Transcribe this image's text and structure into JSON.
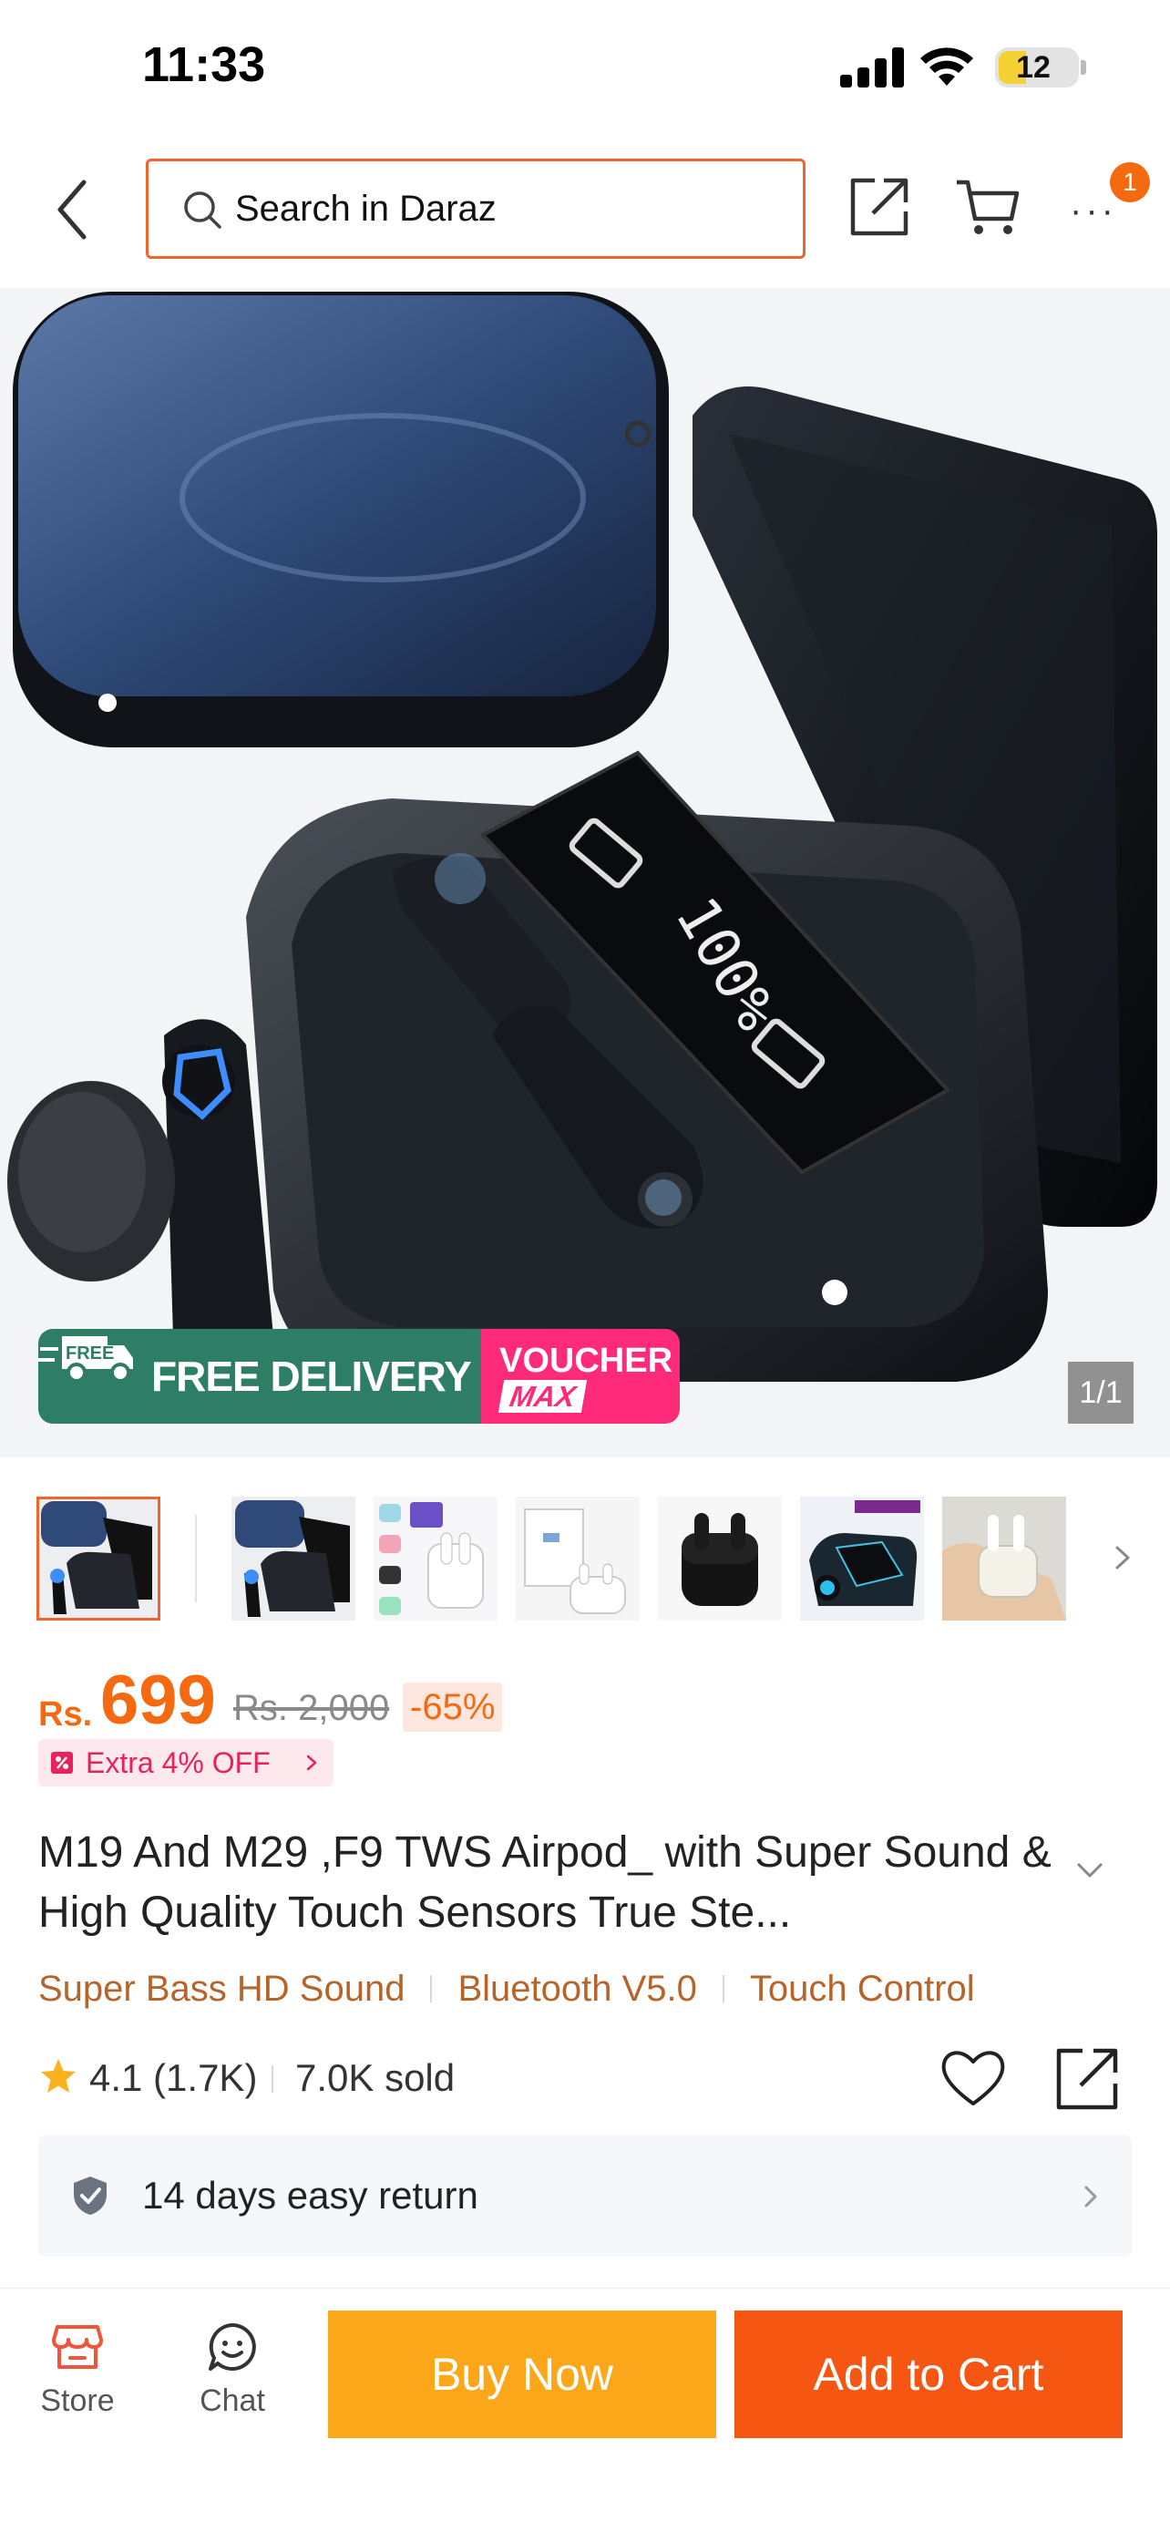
{
  "status_bar": {
    "time": "11:33",
    "battery": "12"
  },
  "header": {
    "search_placeholder": "Search in Daraz",
    "cart_badge": "1"
  },
  "hero": {
    "promo_free": "FREE DELIVERY",
    "promo_truck_text": "FREE",
    "promo_voucher_top": "VOUCHER",
    "promo_voucher_bottom": "MAX",
    "image_counter": "1/1"
  },
  "price": {
    "currency": "Rs.",
    "value": "699",
    "original": "Rs. 2,000",
    "discount": "-65%",
    "extra_offer": "Extra 4% OFF"
  },
  "product": {
    "title": "M19 And M29 ,F9 TWS Airpod_ with Super Sound & High Quality Touch Sensors True Ste...",
    "features": [
      "Super Bass HD Sound",
      "Bluetooth V5.0",
      "Touch Control"
    ],
    "rating": "4.1 (1.7K)",
    "sold": "7.0K sold"
  },
  "service": {
    "return_policy": "14 days easy return"
  },
  "bottom_bar": {
    "store_label": "Store",
    "chat_label": "Chat",
    "buy_now": "Buy Now",
    "add_to_cart": "Add to Cart"
  },
  "icons": {
    "back": "chevron-left-icon",
    "search": "search-icon",
    "share": "share-icon",
    "cart": "cart-icon",
    "more": "more-icon",
    "star": "star-icon",
    "heart": "heart-icon",
    "shield": "shield-check-icon",
    "store": "store-icon",
    "chat": "chat-icon"
  },
  "colors": {
    "brand_orange": "#f56a10",
    "search_border": "#f0652b",
    "buy_now": "#fca71a",
    "add_to_cart": "#f55612",
    "free_delivery": "#2e7d65",
    "voucher": "#ff2a7a",
    "feature_text": "#b5652c"
  }
}
